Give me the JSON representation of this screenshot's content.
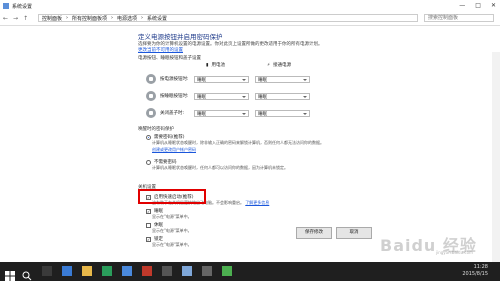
{
  "window": {
    "title": "系统设置"
  },
  "breadcrumb": [
    "控制面板",
    "所有控制面板项",
    "电源选项",
    "系统设置"
  ],
  "search": {
    "placeholder": "搜索控制面板"
  },
  "main": {
    "title": "定义电源按钮并启用密码保护",
    "desc": "选择要为你的计算机设置的电源设置。你对此页上设置所做的更改适用于你的所有电源计划。",
    "link_change": "更改当前不可用的设置",
    "power_section": "电源按钮、睡眠按钮和盖子设置",
    "col_battery": "用电池",
    "col_plugged": "接通电源",
    "rows": [
      {
        "label": "按电源按钮时:",
        "battery": "睡眠",
        "plugged": "睡眠"
      },
      {
        "label": "按睡眠按钮时:",
        "battery": "睡眠",
        "plugged": "睡眠"
      },
      {
        "label": "关闭盖子时:",
        "battery": "睡眠",
        "plugged": "睡眠"
      }
    ],
    "wake_section": "唤醒时的密码保护",
    "radio1": "需要密码(推荐)",
    "radio1_desc": "计算机从睡眠状态唤醒时，除非输入正确的密码来解锁计算机，否则任何人都无法访问你的数据。",
    "radio1_link": "创建或更改用户帐户密码",
    "radio2": "不需要密码",
    "radio2_desc": "计算机从睡眠状态唤醒时，任何人都可以访问你的数据，因为计算机未锁定。",
    "shutdown_section": "关机设置",
    "fast_startup": "启用快速启动(推荐)",
    "fast_startup_desc": "这有助于在关机后更快地启动电脑。不会影响重启。",
    "fast_startup_link": "了解更多信息",
    "sleep": "睡眠",
    "sleep_desc": "显示在\"电源\"菜单中。",
    "hibernate": "休眠",
    "hibernate_desc": "显示在\"电源\"菜单中。",
    "lock": "锁定",
    "lock_desc": "显示在\"电源\"菜单中。"
  },
  "buttons": {
    "save": "保存修改",
    "cancel": "取消"
  },
  "taskbar": {
    "time": "11:28",
    "date": "2015/8/15"
  },
  "watermark": {
    "main": "Baidu 经验",
    "sub": "jingyan.baidu.com"
  },
  "colors": {
    "accent": "#1a56db",
    "highlight": "#e10000",
    "taskbar": "#1f1f1f"
  }
}
